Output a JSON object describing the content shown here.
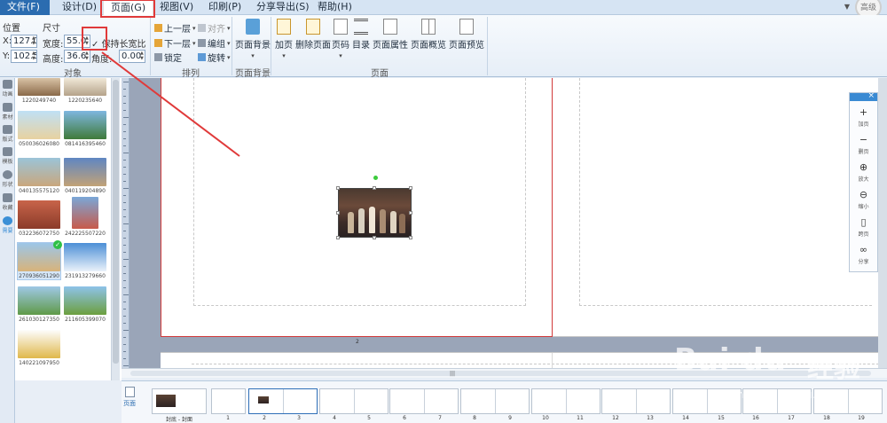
{
  "menu": [
    "文件(F)",
    "设计(D)",
    "页面(G)",
    "视图(V)",
    "印刷(P)",
    "分享导出(S)",
    "帮助(H)"
  ],
  "user_badge": "高级",
  "window_arrow": "▼",
  "ribbon": {
    "position_label": "位置",
    "size_label": "尺寸",
    "x_label": "X:",
    "y_label": "Y:",
    "x_value": "127.0",
    "y_value": "102.5",
    "width_label": "宽度:",
    "height_label": "高度:",
    "width_value": "55.0",
    "height_value": "36.6",
    "keep_ratio": "保持长宽比",
    "angle_label": "角度:",
    "angle_value": "0.00",
    "group_object": "对象",
    "arrange": {
      "up": "上一层",
      "down": "下一层",
      "lock": "锁定",
      "align": "对齐",
      "group": "编组",
      "rotate": "旋转",
      "title": "排列"
    },
    "page_bg": {
      "label": "页面背景",
      "title": "页面背景"
    },
    "page_buttons": [
      "加页",
      "删除页面",
      "页码",
      "目录",
      "页面属性",
      "页面概览",
      "页面预览"
    ],
    "group_page": "页面"
  },
  "sidebar": [
    "动画",
    "素材",
    "版式",
    "模板",
    "形状",
    "收藏",
    "需要"
  ],
  "thumbnails": [
    "1220249740",
    "1220235640",
    "050036026080",
    "081416395460",
    "040135575120",
    "040119204890",
    "032236072750",
    "242225507220",
    "270936051290",
    "231913279660",
    "261030127350",
    "211605399070",
    "140221097950"
  ],
  "canvas": {
    "page_number": "2",
    "scroll_grip": "|||"
  },
  "float_tools": [
    {
      "icon": "+",
      "label": "加页"
    },
    {
      "icon": "−",
      "label": "删页"
    },
    {
      "icon": "⊕",
      "label": "放大"
    },
    {
      "icon": "⊖",
      "label": "缩小"
    },
    {
      "icon": "▯",
      "label": "跨页"
    },
    {
      "icon": "∞",
      "label": "分享"
    }
  ],
  "filmstrip": {
    "side_label": "页面",
    "pages": [
      "封底 - 封面",
      "1",
      "2",
      "3",
      "4",
      "5",
      "6",
      "7",
      "8",
      "9",
      "10",
      "11",
      "12",
      "13",
      "14",
      "15",
      "16",
      "17",
      "18",
      "19"
    ]
  },
  "watermark": {
    "logo": "Bai du",
    "cn": "经验",
    "url": "jingyan.baidu.com"
  }
}
